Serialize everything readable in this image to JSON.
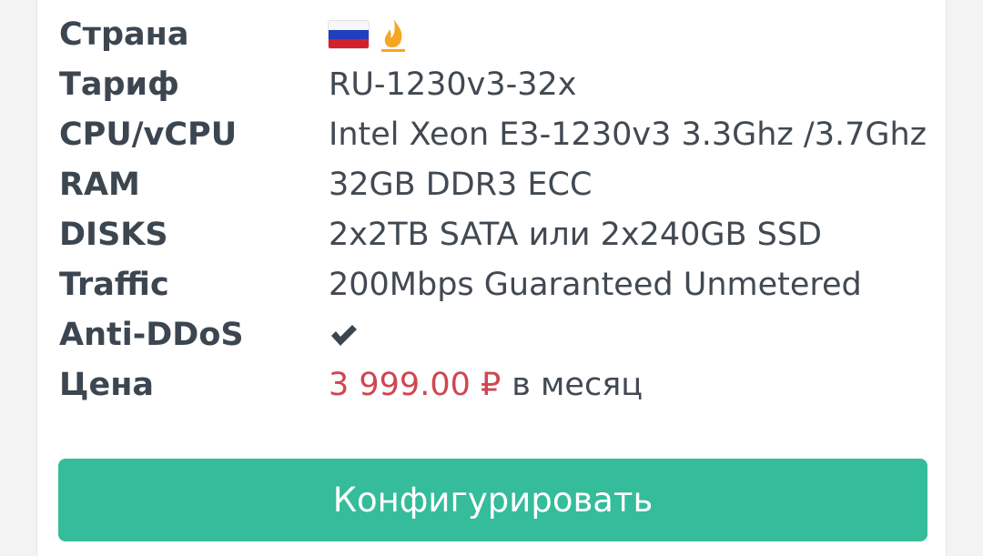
{
  "specs": {
    "country": {
      "label": "Страна",
      "flag_icon": "russia-flag-icon",
      "hot_icon": "fire-icon"
    },
    "tariff": {
      "label": "Тариф",
      "value": "RU-1230v3-32x"
    },
    "cpu": {
      "label": "CPU/vCPU",
      "value": "Intel Xeon E3-1230v3 3.3Ghz /3.7Ghz"
    },
    "ram": {
      "label": "RAM",
      "value": "32GB DDR3 ECC"
    },
    "disks": {
      "label": "DISKS",
      "value": "2x2TB SATA или 2x240GB SSD"
    },
    "traffic": {
      "label": "Traffic",
      "value": "200Mbps Guaranteed Unmetered"
    },
    "antiddos": {
      "label": "Anti-DDoS",
      "icon": "checkmark-icon"
    },
    "price": {
      "label": "Цена",
      "amount": "3 999.00 ₽",
      "period": "в месяц",
      "color": "#cf4650"
    }
  },
  "configure_button": {
    "label": "Конфигурировать",
    "color": "#35bc9a"
  }
}
